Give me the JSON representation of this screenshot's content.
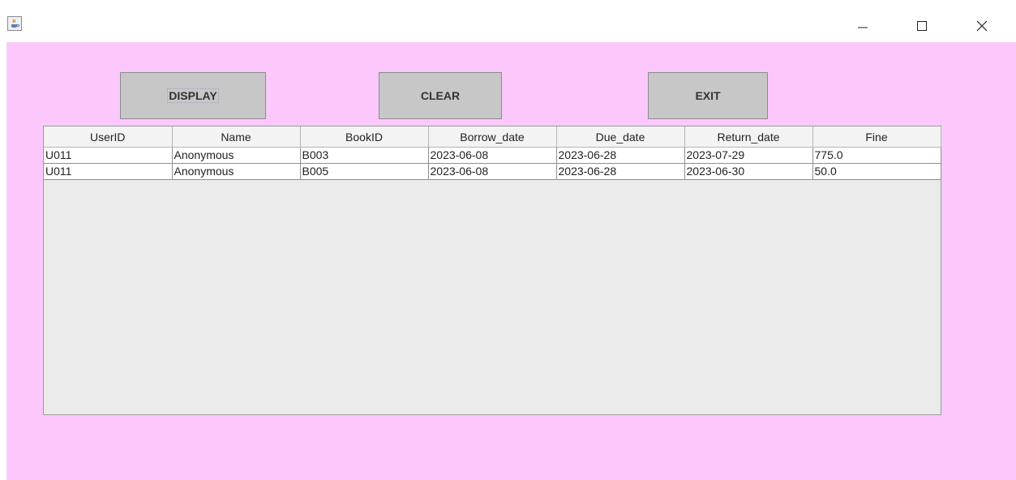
{
  "window": {
    "icons": {
      "app": "java-cup-icon",
      "minimize": "minimize-icon",
      "maximize": "maximize-icon",
      "close": "close-icon"
    }
  },
  "toolbar": {
    "display_label": "DISPLAY",
    "clear_label": "CLEAR",
    "exit_label": "EXIT"
  },
  "table": {
    "columns": [
      "UserID",
      "Name",
      "BookID",
      "Borrow_date",
      "Due_date",
      "Return_date",
      "Fine"
    ],
    "rows": [
      [
        "U011",
        "Anonymous",
        "B003",
        "2023-06-08",
        "2023-06-28",
        "2023-07-29",
        "775.0"
      ],
      [
        "U011",
        "Anonymous",
        "B005",
        "2023-06-08",
        "2023-06-28",
        "2023-06-30",
        "50.0"
      ]
    ]
  },
  "colors": {
    "background": "#fcc8fc",
    "button": "#c7c7c7",
    "table_empty_area": "#ebebeb"
  }
}
